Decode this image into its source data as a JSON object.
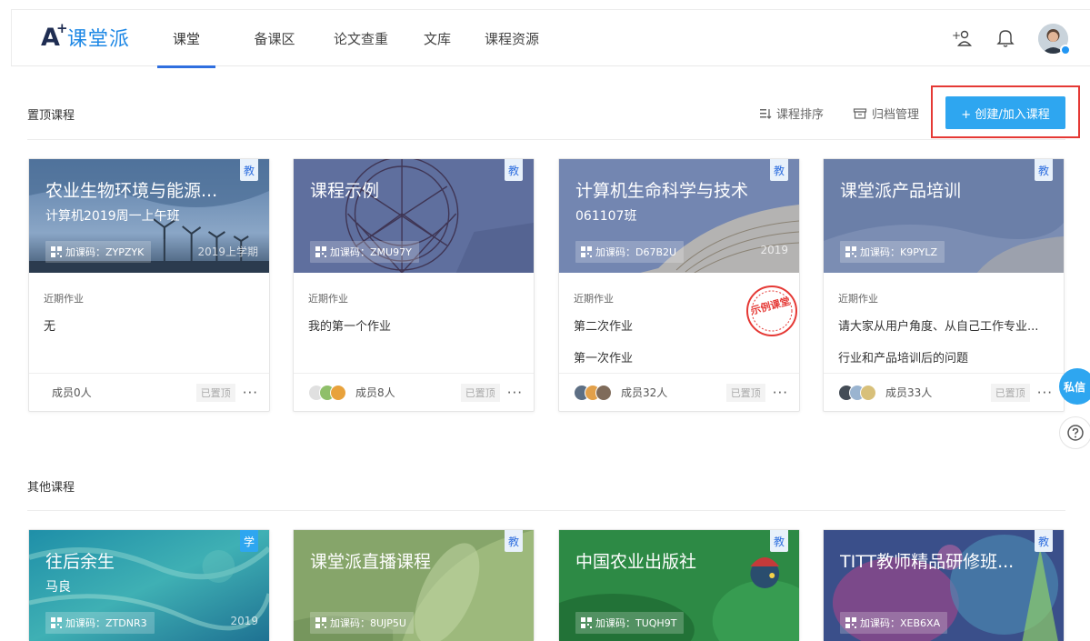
{
  "header": {
    "logo_mark": "A",
    "logo_plus": "+",
    "logo_text": "课堂派",
    "nav": [
      {
        "label": "课堂",
        "active": true
      },
      {
        "label": "备课区"
      },
      {
        "label": "论文查重"
      },
      {
        "label": "文库"
      },
      {
        "label": "课程资源"
      }
    ],
    "icons": [
      "add-contact-icon",
      "bell-icon",
      "user-avatar"
    ]
  },
  "pinned_section": {
    "title": "置顶课程",
    "sort_label": "课程排序",
    "archive_label": "归档管理",
    "create_label": "+ 创建/加入课程"
  },
  "other_section": {
    "title": "其他课程"
  },
  "labels": {
    "recent_homework": "近期作业",
    "pinned": "已置顶",
    "more": "···"
  },
  "pinned_courses": [
    {
      "badge": "教",
      "title": "农业生物环境与能源...",
      "subtitle": "计算机2019周一上午班",
      "code": "加课码：ZYPZYK",
      "term": "2019上学期",
      "homework": [
        "无"
      ],
      "members": "成员0人"
    },
    {
      "badge": "教",
      "title": "课程示例",
      "subtitle": "",
      "code": "加课码：ZMU97Y",
      "term": "",
      "homework": [
        "我的第一个作业"
      ],
      "members": "成员8人"
    },
    {
      "badge": "教",
      "title": "计算机生命科学与技术",
      "subtitle": "061107班",
      "code": "加课码：D67B2U",
      "term": "2019",
      "homework": [
        "第二次作业",
        "第一次作业"
      ],
      "members": "成员32人",
      "stamp": "示例课堂"
    },
    {
      "badge": "教",
      "title": "课堂派产品培训",
      "subtitle": "",
      "code": "加课码：K9PYLZ",
      "term": "",
      "homework": [
        "请大家从用户角度、从自己工作专业...",
        "行业和产品培训后的问题"
      ],
      "members": "成员33人"
    }
  ],
  "other_courses": [
    {
      "badge": "学",
      "title": "往后余生",
      "subtitle": "马良",
      "code": "加课码：ZTDNR3",
      "term": "2019"
    },
    {
      "badge": "教",
      "title": "课堂派直播课程",
      "subtitle": "",
      "code": "加课码：8UJP5U",
      "term": ""
    },
    {
      "badge": "教",
      "title": "中国农业出版社",
      "subtitle": "",
      "code": "加课码：TUQH9T",
      "term": ""
    },
    {
      "badge": "教",
      "title": "TITT教师精品研修班...",
      "subtitle": "",
      "code": "加课码：XEB6XA",
      "term": ""
    }
  ],
  "side": {
    "message_label": "私信",
    "help_icon": "question-circle-icon"
  }
}
